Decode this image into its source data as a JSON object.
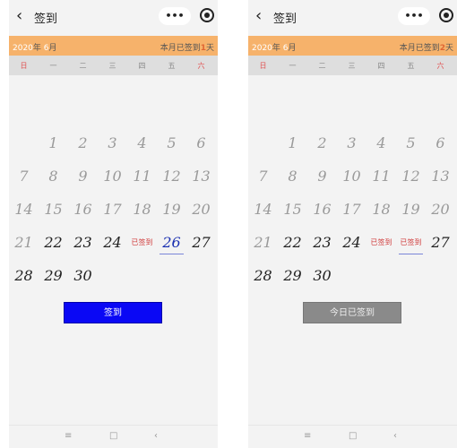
{
  "screens": [
    {
      "nav": {
        "back_icon": "‹",
        "title": "签到",
        "capsule_dots": "•••"
      },
      "banner": {
        "year": "2020",
        "year_suffix": "年",
        "month": "6",
        "month_suffix": "月",
        "count_label": "本月已签到",
        "count_value": "1",
        "count_unit": "天"
      },
      "weekdays": [
        "日",
        "一",
        "二",
        "三",
        "四",
        "五",
        "六"
      ],
      "rows": [
        [
          "",
          "1",
          "2",
          "3",
          "4",
          "5",
          "6"
        ],
        [
          "7",
          "8",
          "9",
          "10",
          "11",
          "12",
          "13"
        ],
        [
          "14",
          "15",
          "16",
          "17",
          "18",
          "19",
          "20"
        ],
        [
          "21",
          "22",
          "23",
          "24",
          "已签到",
          "26",
          "27"
        ],
        [
          "28",
          "29",
          "30",
          "",
          "",
          "",
          ""
        ]
      ],
      "button_label": "签到",
      "bottom_nav": [
        "≡",
        "□",
        "‹"
      ]
    },
    {
      "nav": {
        "back_icon": "‹",
        "title": "签到",
        "capsule_dots": "•••"
      },
      "banner": {
        "year": "2020",
        "year_suffix": "年",
        "month": "6",
        "month_suffix": "月",
        "count_label": "本月已签到",
        "count_value": "2",
        "count_unit": "天"
      },
      "weekdays": [
        "日",
        "一",
        "二",
        "三",
        "四",
        "五",
        "六"
      ],
      "rows": [
        [
          "",
          "1",
          "2",
          "3",
          "4",
          "5",
          "6"
        ],
        [
          "7",
          "8",
          "9",
          "10",
          "11",
          "12",
          "13"
        ],
        [
          "14",
          "15",
          "16",
          "17",
          "18",
          "19",
          "20"
        ],
        [
          "21",
          "22",
          "23",
          "24",
          "已签到",
          "已签到",
          "27"
        ],
        [
          "28",
          "29",
          "30",
          "",
          "",
          "",
          ""
        ]
      ],
      "button_label": "今日已签到",
      "bottom_nav": [
        "≡",
        "□",
        "‹"
      ]
    }
  ],
  "colors": {
    "banner": "#f6b26b",
    "weekday_bar": "#dedede",
    "sign_button": "#0a08f5",
    "signed_text": "#d03a3a",
    "done_button": "#8a8a8a"
  }
}
